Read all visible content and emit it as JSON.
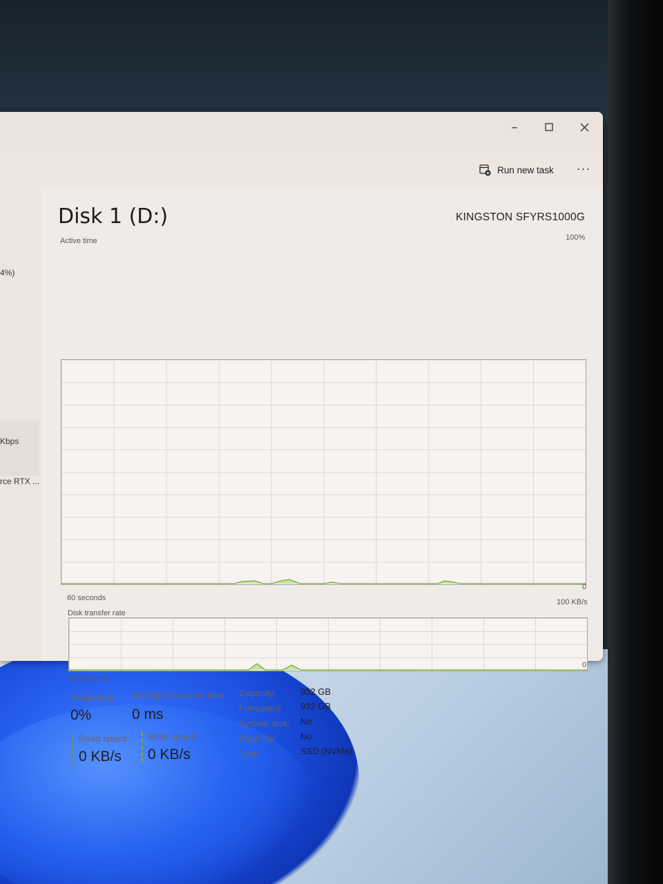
{
  "window": {
    "controls": {
      "minimize": "–",
      "maximize": "☐",
      "close": "✕"
    }
  },
  "toolbar": {
    "run_new_task": "Run new task",
    "more": "···"
  },
  "left_panel": {
    "items": [
      "4%)",
      "Kbps",
      "rce RTX ..."
    ]
  },
  "disk": {
    "title": "Disk 1 (D:)",
    "model": "KINGSTON SFYRS1000G"
  },
  "active_graph": {
    "label": "Active time",
    "max_label": "100%",
    "min_label": "0",
    "time_label": "60 seconds"
  },
  "transfer_graph": {
    "label": "Disk transfer rate",
    "max_label": "100 KB/s",
    "min_label": "0",
    "time_label": "60 seconds"
  },
  "stats": {
    "active_time": {
      "label": "Active time",
      "value": "0%"
    },
    "avg_response": {
      "label": "Average response time",
      "value": "0 ms"
    },
    "read_speed": {
      "label": "Read speed",
      "value": "0 KB/s"
    },
    "write_speed": {
      "label": "Write speed",
      "value": "0 KB/s"
    }
  },
  "properties": [
    {
      "label": "Capacity:",
      "value": "932 GB"
    },
    {
      "label": "Formatted:",
      "value": "932 GB"
    },
    {
      "label": "System disk:",
      "value": "No"
    },
    {
      "label": "Page file:",
      "value": "No"
    },
    {
      "label": "Type:",
      "value": "SSD (NVMe)"
    }
  ],
  "colors": {
    "graph_line": "#6fae2f",
    "graph_fill": "#c9e3a6",
    "accent": "#6b9c2a"
  }
}
